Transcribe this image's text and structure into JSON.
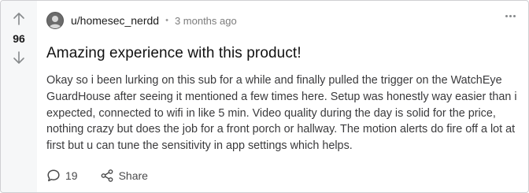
{
  "post": {
    "score": "96",
    "author": "u/homesec_nerdd",
    "separator": "•",
    "time": "3 months ago",
    "title": "Amazing experience with this product!",
    "body": "Okay so i been lurking on this sub for a while and finally pulled the trigger on the WatchEye GuardHouse after seeing it mentioned a few times here. Setup was honestly way easier than i expected, connected to wifi in like 5 min. Video quality during the day is solid for the price, nothing crazy but does the job for a front porch or hallway. The motion alerts do fire off a lot at first but u can tune the sensitivity in app settings which helps.",
    "comments_count": "19",
    "share_label": "Share"
  },
  "icons": {
    "upvote": "arrow-up-icon",
    "downvote": "arrow-down-icon",
    "more": "ellipsis-icon",
    "comment": "comment-bubble-icon",
    "share": "share-icon"
  },
  "colors": {
    "vote_column_bg": "#f6f7f8",
    "icon_gray": "#878a8c",
    "text_primary": "#1a1a1b"
  }
}
